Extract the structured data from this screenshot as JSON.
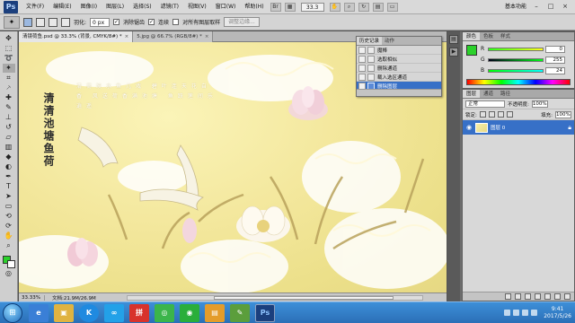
{
  "app": {
    "logo_text": "Ps"
  },
  "menubar": {
    "items": [
      "文件(F)",
      "编辑(E)",
      "图像(I)",
      "图层(L)",
      "选择(S)",
      "滤镜(T)",
      "视图(V)",
      "窗口(W)",
      "帮助(H)"
    ],
    "zoom_value": "33.3",
    "workspace_label": "基本功能"
  },
  "optionsbar": {
    "feather_label": "羽化:",
    "feather_value": "0 px",
    "antialias_label": "消除锯齿",
    "style_label": "连续",
    "sample_all_label": "对所有图层取样",
    "refine_edge_label": "调整边缘..."
  },
  "document": {
    "tabs": [
      {
        "label": "清镜荷鱼.psd @ 33.3% (背景, CMYK/8#) *",
        "close": "×"
      },
      {
        "label": "5.jpg @ 66.7% (RGB/8#) *",
        "close": "×"
      }
    ],
    "calligraphy": "清清池塘鱼荷",
    "poem": "清荷映水鱼儿戏 碧叶连天花自香 风送荷香满池塘 鱼跃莲间乐逍遥",
    "status_zoom": "33.33%",
    "status_doc": "文档:21.9M/26.9M"
  },
  "actions_panel": {
    "tabs": [
      "历史记录",
      "动作"
    ],
    "items": [
      {
        "label": "魔棒",
        "selected": false
      },
      {
        "label": "选取相似",
        "selected": false
      },
      {
        "label": "删除通道",
        "selected": false
      },
      {
        "label": "载入选区通道",
        "selected": false
      },
      {
        "label": "删除图层",
        "selected": true
      }
    ]
  },
  "color_panel": {
    "tabs": [
      "颜色",
      "色板",
      "样式"
    ],
    "channels": [
      {
        "label": "R",
        "value": "0"
      },
      {
        "label": "G",
        "value": "255"
      },
      {
        "label": "B",
        "value": "24"
      }
    ],
    "foreground": "#2bd12b"
  },
  "layers_panel": {
    "tabs": [
      "图层",
      "通道",
      "路径"
    ],
    "blend_mode": "正常",
    "opacity_label": "不透明度:",
    "opacity_value": "100%",
    "lock_label": "锁定:",
    "fill_label": "填充:",
    "fill_value": "100%",
    "layer_name": "图层 0"
  },
  "taskbar": {
    "apps": [
      {
        "name": "ie",
        "label": "e"
      },
      {
        "name": "folder",
        "label": "▣"
      },
      {
        "name": "kugou",
        "label": "K"
      },
      {
        "name": "cloud",
        "label": "∞"
      },
      {
        "name": "qq-pinyin",
        "label": "拼"
      },
      {
        "name": "360",
        "label": "◎"
      },
      {
        "name": "wechat",
        "label": "◉"
      },
      {
        "name": "viewer",
        "label": "▤"
      },
      {
        "name": "paint",
        "label": "✎"
      },
      {
        "name": "photoshop",
        "label": "Ps"
      }
    ],
    "time": "9:41",
    "date": "2017/5/26"
  }
}
